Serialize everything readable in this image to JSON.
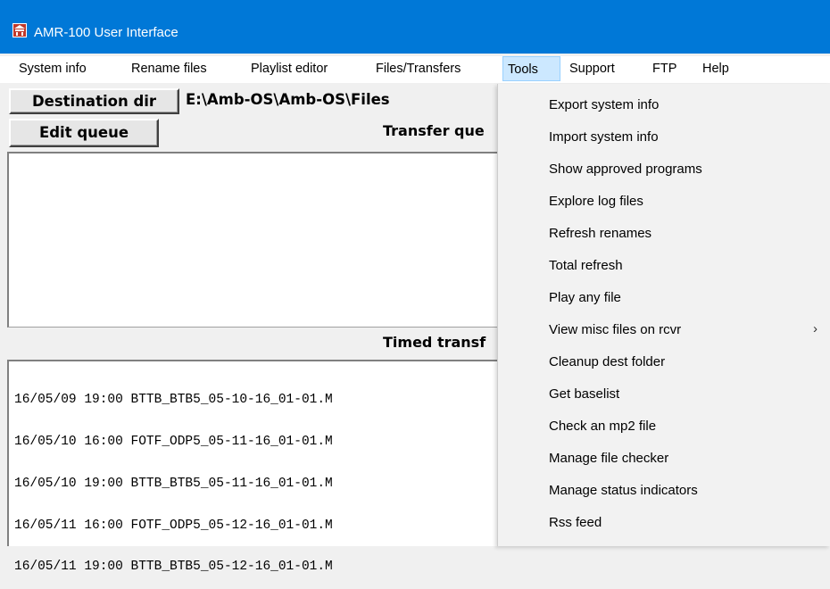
{
  "window": {
    "title": "AMR-100 User Interface"
  },
  "menubar": {
    "items": [
      {
        "label": "System info"
      },
      {
        "label": "Rename files"
      },
      {
        "label": "Playlist editor"
      },
      {
        "label": "Files/Transfers"
      },
      {
        "label": "Tools"
      },
      {
        "label": "Support"
      },
      {
        "label": "FTP"
      },
      {
        "label": "Help"
      }
    ],
    "active": "Tools"
  },
  "main": {
    "destination_button": "Destination dir",
    "destination_path": "E:\\Amb-OS\\Amb-OS\\Files",
    "edit_queue_button": "Edit queue",
    "transfer_queue_header": "Transfer que",
    "timed_header": "Timed transf",
    "timed_items": [
      "16/05/09 19:00 BTTB_BTB5_05-10-16_01-01.M",
      "16/05/10 16:00 FOTF_ODP5_05-11-16_01-01.M",
      "16/05/10 19:00 BTTB_BTB5_05-11-16_01-01.M",
      "16/05/11 16:00 FOTF_ODP5_05-12-16_01-01.M",
      "16/05/11 19:00 BTTB_BTB5_05-12-16_01-01.M"
    ]
  },
  "tools_menu": {
    "items": [
      {
        "label": "Export system info"
      },
      {
        "label": "Import system info"
      },
      {
        "label": "Show approved programs"
      },
      {
        "label": "Explore log files"
      },
      {
        "label": "Refresh renames"
      },
      {
        "label": "Total refresh"
      },
      {
        "label": "Play any file"
      },
      {
        "label": "View misc files on rcvr",
        "submenu_arrow": "›"
      },
      {
        "label": "Cleanup dest folder"
      },
      {
        "label": "Get baselist"
      },
      {
        "label": "Check an mp2 file"
      },
      {
        "label": "Manage file checker"
      },
      {
        "label": "Manage status indicators"
      },
      {
        "label": "Rss feed"
      }
    ]
  },
  "colors": {
    "titlebar": "#0078d7",
    "menu_active": "#cce8ff",
    "icon": "#c0392b"
  }
}
